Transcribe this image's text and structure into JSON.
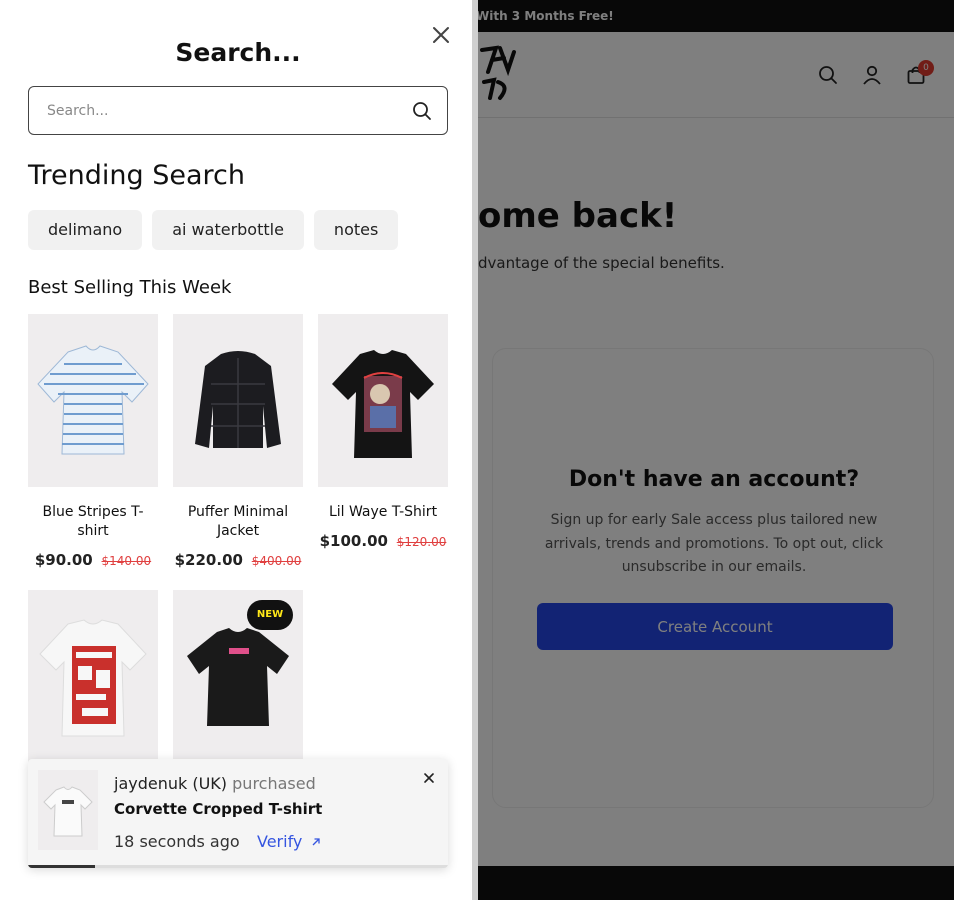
{
  "background_page": {
    "announcement": "With 3 Months Free!",
    "cart_count": "0",
    "welcome_heading": "ome back!",
    "welcome_sub": "dvantage of the special benefits.",
    "signup_card": {
      "title": "Don't have an account?",
      "text": "Sign up for early Sale access plus tailored new arrivals, trends and promotions. To opt out, click unsubscribe in our emails.",
      "button": "Create Account"
    }
  },
  "search_drawer": {
    "title": "Search...",
    "search": {
      "placeholder": "Search...",
      "value": ""
    },
    "trending_title": "Trending Search",
    "trending": [
      "delimano",
      "ai waterbottle",
      "notes"
    ],
    "best_selling_title": "Best Selling This Week",
    "products": [
      {
        "name": "Blue Stripes T-shirt",
        "price": "$90.00",
        "compare_price": "$140.00",
        "image": "striped-tshirt-image"
      },
      {
        "name": "Puffer Minimal Jacket",
        "price": "$220.00",
        "compare_price": "$400.00",
        "image": "black-puffer-jacket-image"
      },
      {
        "name": "Lil Waye T-Shirt",
        "price": "$100.00",
        "compare_price": "$120.00",
        "image": "graphic-black-tshirt-image"
      },
      {
        "name": "",
        "price": "",
        "compare_price": "",
        "image": "white-graphic-tshirt-image"
      },
      {
        "name": "",
        "price": "",
        "compare_price": "",
        "image": "black-cropped-tshirt-image",
        "badge": "NEW"
      }
    ]
  },
  "purchase_toast": {
    "customer": "jaydenuk (UK)",
    "action": "purchased",
    "product": "Corvette Cropped T-shirt",
    "time": "18 seconds ago",
    "verify": "Verify",
    "progress": 0.16
  },
  "colors": {
    "accent_blue": "#2547e8",
    "sale_red": "#e04040",
    "badge_yellow": "#ffe818",
    "announcement_bg": "#111111"
  }
}
